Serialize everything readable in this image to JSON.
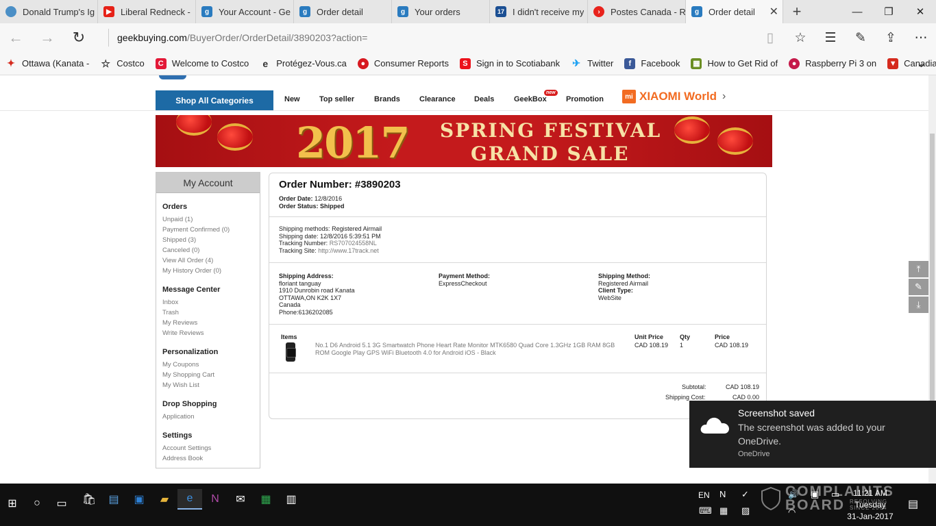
{
  "browser": {
    "tabs": [
      {
        "title": "Donald Trump's Ig",
        "color": "#4b8fc6"
      },
      {
        "title": "Liberal Redneck -",
        "color": "#e62117"
      },
      {
        "title": "Your Account - Ge",
        "color": "#2a7bbf"
      },
      {
        "title": "Order detail",
        "color": "#2a7bbf"
      },
      {
        "title": "Your orders",
        "color": "#2a7bbf"
      },
      {
        "title": "I didn't receive my",
        "color": "#1b4f93"
      },
      {
        "title": "Postes Canada - R",
        "color": "#e8231c"
      },
      {
        "title": "Order detail",
        "color": "#2a7bbf",
        "active": true
      }
    ],
    "url_host": "geekbuying.com",
    "url_path": "/BuyerOrder/OrderDetail/3890203?action=",
    "favorites": [
      {
        "label": "Ottawa (Kanata -",
        "icon": "maple-leaf-icon",
        "color": "#d52b1e"
      },
      {
        "label": "Costco",
        "icon": "star-outline-icon",
        "color": "#ffffff"
      },
      {
        "label": "Welcome to Costco",
        "icon": "costco-icon",
        "color": "#e31837"
      },
      {
        "label": "Protégez-Vous.ca",
        "icon": "e-icon",
        "color": "#ffffff"
      },
      {
        "label": "Consumer Reports",
        "icon": "consumer-reports-icon",
        "color": "#d71920"
      },
      {
        "label": "Sign in to Scotiabank",
        "icon": "scotiabank-icon",
        "color": "#ec111a"
      },
      {
        "label": "Twitter",
        "icon": "twitter-icon",
        "color": "#1da1f2"
      },
      {
        "label": "Facebook",
        "icon": "facebook-icon",
        "color": "#3b5998"
      },
      {
        "label": "How to Get Rid of",
        "icon": "guide-icon",
        "color": "#6b8e23"
      },
      {
        "label": "Raspberry Pi 3 on",
        "icon": "raspberry-icon",
        "color": "#c51a4a"
      },
      {
        "label": "Canadian Tire",
        "icon": "canadian-tire-icon",
        "color": "#d52b1e"
      }
    ]
  },
  "site": {
    "shop_all": "Shop All Categories",
    "nav": [
      "New",
      "Top seller",
      "Brands",
      "Clearance",
      "Deals",
      "GeekBox",
      "Promotion"
    ],
    "new_badge": "new",
    "xiaomi_mark": "mi",
    "xiaomi": "XIAOMI World",
    "banner": {
      "year": "2017",
      "line1": "SPRING FESTIVAL",
      "line2": "GRAND SALE"
    }
  },
  "sidebar": {
    "title": "My Account",
    "groups": [
      {
        "heading": "Orders",
        "links": [
          "Unpaid (1)",
          "Payment Confirmed (0)",
          "Shipped (3)",
          "Canceled (0)",
          "View All Order (4)",
          "My History Order (0)"
        ]
      },
      {
        "heading": "Message Center",
        "links": [
          "Inbox",
          "Trash",
          "My Reviews",
          "Write Reviews"
        ]
      },
      {
        "heading": "Personalization",
        "links": [
          "My Coupons",
          "My Shopping Cart",
          "My Wish List"
        ]
      },
      {
        "heading": "Drop Shopping",
        "links": [
          "Application"
        ]
      },
      {
        "heading": "Settings",
        "links": [
          "Account Settings",
          "Address Book"
        ]
      }
    ]
  },
  "order": {
    "number": "Order Number: #3890203",
    "date_label": "Order Date:",
    "date": "12/8/2016",
    "status_label": "Order Status:",
    "status": "Shipped",
    "ship_methods_label": "Shipping methods:",
    "ship_methods": "Registered Airmail",
    "ship_date_label": "Shipping date:",
    "ship_date": "12/8/2016 5:39:51 PM",
    "tracking_label": "Tracking Number:",
    "tracking": "RS707024558NL",
    "tracking_site_label": "Tracking Site:",
    "tracking_site": "http://www.17track.net",
    "address_label": "Shipping Address:",
    "address_lines": [
      "floriant tanguay",
      "1910 Dunrobin road Kanata",
      "OTTAWA,ON K2K 1X7",
      "Canada",
      "Phone:6136202085"
    ],
    "payment_label": "Payment Method:",
    "payment": "ExpressCheckout",
    "shipping_method_label": "Shipping Method:",
    "shipping_method": "Registered Airmail",
    "client_type_label": "Client Type:",
    "client_type": "WebSite",
    "items_header": "Items",
    "unit_price_header": "Unit Price",
    "qty_header": "Qty",
    "price_header": "Price",
    "item": {
      "desc": "No.1 D6 Android 5.1 3G Smartwatch Phone Heart Rate Monitor MTK6580 Quad Core 1.3GHz 1GB RAM 8GB ROM Google Play GPS WiFi Bluetooth 4.0 for Android iOS - Black",
      "unit_price": "CAD 108.19",
      "qty": "1",
      "price": "CAD 108.19"
    },
    "subtotal_label": "Subtotal:",
    "subtotal": "CAD 108.19",
    "shipping_cost_label": "Shipping Cost:",
    "shipping_cost": "CAD 0.00"
  },
  "toast": {
    "title": "Screenshot saved",
    "body": "The screenshot was added to your OneDrive.",
    "source": "OneDrive"
  },
  "taskbar": {
    "lang": "EN",
    "time": "11:21 AM",
    "day": "Tuesday",
    "date": "31-Jan-2017"
  },
  "watermark": {
    "line1": "COMPLAINTS",
    "line2": "BOARD",
    "tag1": "RESOLVING",
    "tag2": "SINCE 2004"
  }
}
